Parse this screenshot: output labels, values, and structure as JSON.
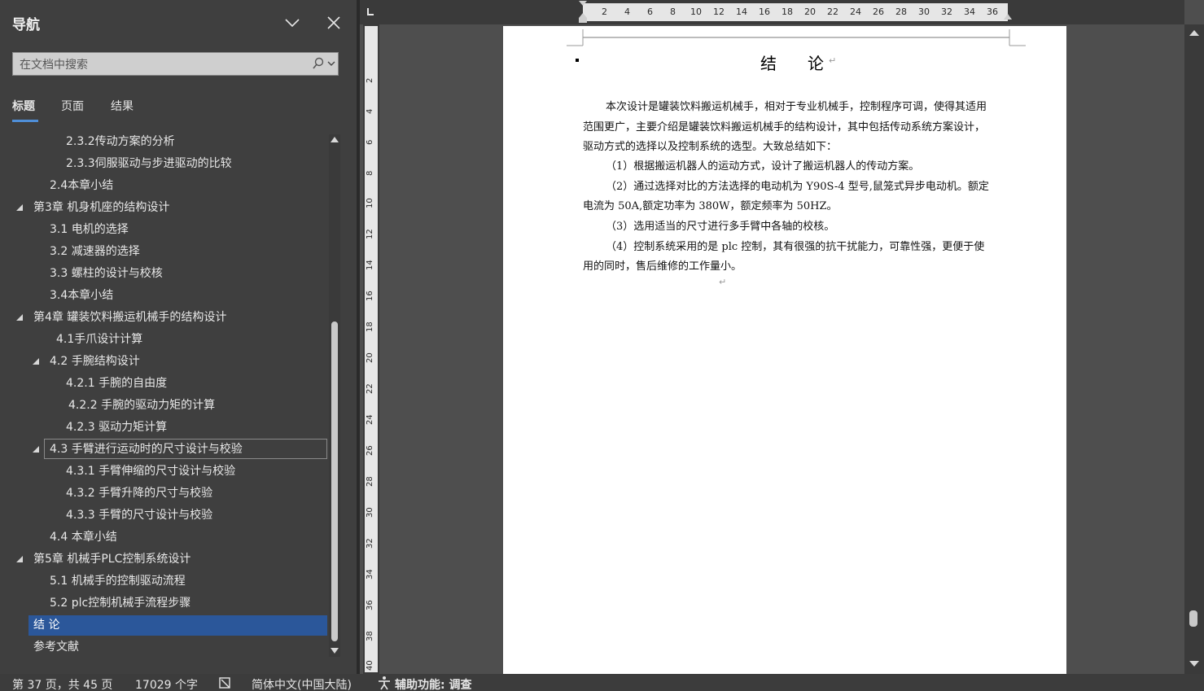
{
  "nav": {
    "title": "导航",
    "search_placeholder": "在文档中搜索",
    "tabs": [
      "标题",
      "页面",
      "结果"
    ],
    "items": [
      {
        "label": "2.3.2传动方案的分析"
      },
      {
        "label": "2.3.3伺服驱动与步进驱动的比较"
      },
      {
        "label": "2.4本章小结"
      },
      {
        "label": "第3章  机身机座的结构设计"
      },
      {
        "label": "3.1  电机的选择"
      },
      {
        "label": "3.2 减速器的选择"
      },
      {
        "label": "3.3  螺柱的设计与校核"
      },
      {
        "label": "3.4本章小结"
      },
      {
        "label": "第4章  罐装饮料搬运机械手的结构设计"
      },
      {
        "label": "4.1手爪设计计算"
      },
      {
        "label": "4.2  手腕结构设计"
      },
      {
        "label": "4.2.1  手腕的自由度"
      },
      {
        "label": "4.2.2  手腕的驱动力矩的计算"
      },
      {
        "label": "4.2.3  驱动力矩计算"
      },
      {
        "label": "4.3  手臂进行运动时的尺寸设计与校验"
      },
      {
        "label": "4.3.1 手臂伸缩的尺寸设计与校验"
      },
      {
        "label": "4.3.2 手臂升降的尺寸与校验"
      },
      {
        "label": "4.3.3 手臂的尺寸设计与校验"
      },
      {
        "label": "4.4 本章小结"
      },
      {
        "label": "第5章  机械手PLC控制系统设计"
      },
      {
        "label": "5.1 机械手的控制驱动流程"
      },
      {
        "label": "5.2 plc控制机械手流程步骤"
      },
      {
        "label": "结    论"
      },
      {
        "label": "参考文献"
      }
    ]
  },
  "ruler": {
    "h_numbers": [
      "2",
      "4",
      "6",
      "8",
      "10",
      "12",
      "14",
      "16",
      "18",
      "20",
      "22",
      "24",
      "26",
      "28",
      "30",
      "32",
      "34",
      "36"
    ],
    "v_numbers": [
      "2",
      "4",
      "6",
      "8",
      "10",
      "12",
      "14",
      "16",
      "18",
      "20",
      "22",
      "24",
      "26",
      "28",
      "30",
      "32",
      "34",
      "36",
      "38",
      "40"
    ]
  },
  "document": {
    "title": "结论",
    "lines": [
      "本次设计是罐装饮料搬运机械手，相对于专业机械手，控制程序可调，使得其适用",
      "范围更广，主要介绍是罐装饮料搬运机械手的结构设计，其中包括传动系统方案设计，",
      "驱动方式的选择以及控制系统的选型。大致总结如下：",
      "（1）根据搬运机器人的运动方式，设计了搬运机器人的传动方案。",
      "（2）通过选择对比的方法选择的电动机为  Y90S-4  型号,鼠笼式异步电动机。额定",
      "电流为  50A,额定功率为 380W，额定频率为 50HZ。",
      "（3）选用适当的尺寸进行多手臂中各轴的校核。",
      "（4）控制系统采用的是 plc 控制，其有很强的抗干扰能力，可靠性强，更便于使",
      "用的同时，售后维修的工作量小。"
    ],
    "paragraph_mark": "↵"
  },
  "status": {
    "page": "第 37 页，共 45 页",
    "words": "17029 个字",
    "language": "简体中文(中国大陆)",
    "accessibility": "辅助功能: 调查"
  }
}
